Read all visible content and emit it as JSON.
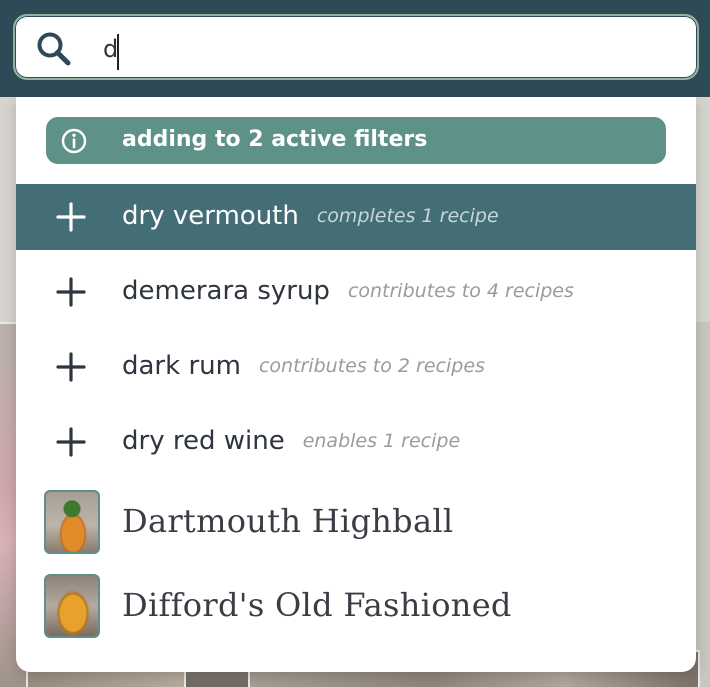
{
  "search": {
    "value": "d"
  },
  "dropdown": {
    "info": {
      "icon": "info-circle-icon",
      "text": "adding to 2 active filters"
    },
    "ingredients": [
      {
        "label": "dry vermouth",
        "hint": "completes 1 recipe",
        "icon": "plus-icon",
        "highlighted": true
      },
      {
        "label": "demerara syrup",
        "hint": "contributes to 4 recipes",
        "icon": "plus-icon",
        "highlighted": false
      },
      {
        "label": "dark rum",
        "hint": "contributes to 2 recipes",
        "icon": "plus-icon",
        "highlighted": false
      },
      {
        "label": "dry red wine",
        "hint": "enables 1 recipe",
        "icon": "plus-icon",
        "highlighted": false
      }
    ],
    "recipes": [
      {
        "label": "Dartmouth Highball"
      },
      {
        "label": "Difford's Old Fashioned"
      }
    ]
  },
  "colors": {
    "header": "#2f4a57",
    "info_pill": "#5e9187",
    "highlight_row": "#436e75",
    "search_border": "#8fb49b"
  }
}
